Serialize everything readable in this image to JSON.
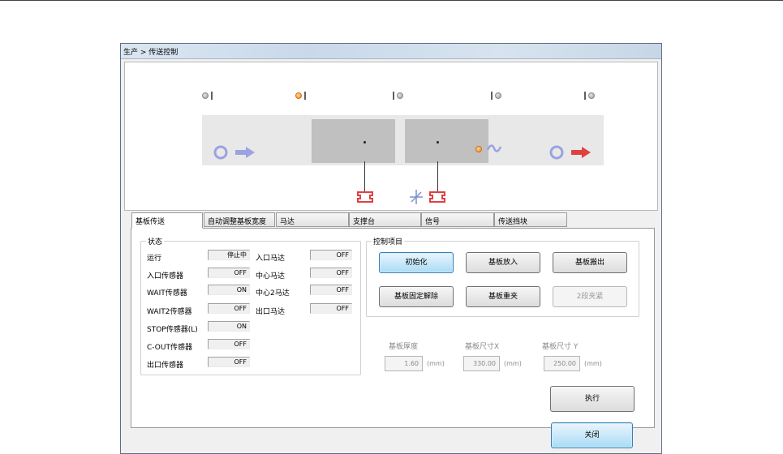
{
  "window": {
    "breadcrumb": "生产 > 传送控制"
  },
  "sensor_states": [
    "off",
    "on",
    "off",
    "off",
    "off"
  ],
  "colors": {
    "sensor_on": "#f08a20",
    "sensor_off": "#9a9a9a",
    "arrow_in": "#9aa2e2",
    "arrow_out": "#e04040",
    "clamp": "#e04040"
  },
  "icons": [
    "ring-icon",
    "arrow-right-icon",
    "wave-icon",
    "clamp-icon",
    "asterisk-icon"
  ],
  "tabs": [
    "基板传送",
    "自动调整基板宽度",
    "马达",
    "支撑台",
    "信号",
    "传送挡块"
  ],
  "status": {
    "title": "状态",
    "left": [
      {
        "label": "运行",
        "value": "停止中"
      },
      {
        "label": "入口传感器",
        "value": "OFF"
      },
      {
        "label": "WAIT传感器",
        "value": "ON"
      },
      {
        "label": "WAIT2传感器",
        "value": "OFF"
      },
      {
        "label": "STOP传感器(L)",
        "value": "ON"
      },
      {
        "label": "C-OUT传感器",
        "value": "OFF"
      },
      {
        "label": "出口传感器",
        "value": "OFF"
      }
    ],
    "right": [
      {
        "label": "入口马达",
        "value": "OFF"
      },
      {
        "label": "中心马达",
        "value": "OFF"
      },
      {
        "label": "中心2马达",
        "value": "OFF"
      },
      {
        "label": "出口马达",
        "value": "OFF"
      }
    ]
  },
  "control": {
    "title": "控制项目",
    "buttons": [
      "初始化",
      "基板放入",
      "基板搬出",
      "基板固定解除",
      "基板重夹",
      "2段夹紧"
    ]
  },
  "dims": [
    {
      "label": "基板厚度",
      "value": "1.60",
      "unit": "(mm)"
    },
    {
      "label": "基板尺寸X",
      "value": "330.00",
      "unit": "(mm)"
    },
    {
      "label": "基板尺寸 Y",
      "value": "250.00",
      "unit": "(mm)"
    }
  ],
  "execute_label": "执行",
  "close_label": "关闭"
}
